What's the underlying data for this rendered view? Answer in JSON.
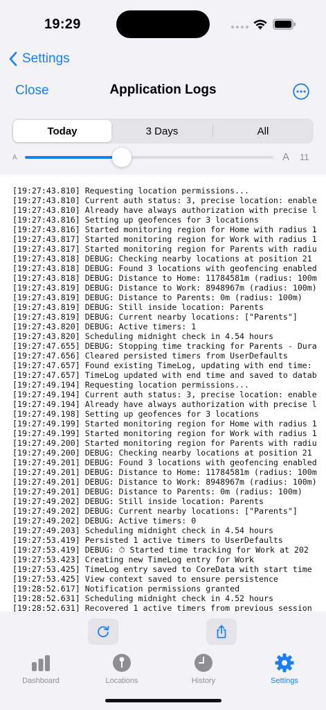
{
  "status_bar": {
    "time": "19:29"
  },
  "nav": {
    "back_label": "Settings",
    "close_label": "Close",
    "title": "Application Logs"
  },
  "segments": [
    "Today",
    "3 Days",
    "All"
  ],
  "slider": {
    "min_label": "A",
    "max_label": "A",
    "value": "11",
    "fraction": 0.39
  },
  "logs": [
    "[19:27:43.810] Requesting location permissions...",
    "[19:27:43.810] Current auth status: 3, precise location: enable",
    "[19:27:43.810] Already have always authorization with precise l",
    "[19:27:43.816] Setting up geofences for 3 locations",
    "[19:27:43.816] Started monitoring region for Home with radius 1",
    "[19:27:43.817] Started monitoring region for Work with radius 1",
    "[19:27:43.817] Started monitoring region for Parents with radiu",
    "[19:27:43.818] DEBUG: Checking nearby locations at position 21",
    "[19:27:43.818] DEBUG: Found 3 locations with geofencing enabled",
    "[19:27:43.818] DEBUG: Distance to Home: 11784581m (radius: 100m",
    "[19:27:43.819] DEBUG: Distance to Work: 8948967m (radius: 100m)",
    "[19:27:43.819] DEBUG: Distance to Parents: 0m (radius: 100m)",
    "[19:27:43.819] DEBUG: Still inside location: Parents",
    "[19:27:43.819] DEBUG: Current nearby locations: [\"Parents\"]",
    "[19:27:43.820] DEBUG: Active timers: 1",
    "[19:27:43.820] Scheduling midnight check in 4.54 hours",
    "[19:27:47.655] DEBUG: Stopping time tracking for Parents - Dura",
    "[19:27:47.656] Cleared persisted timers from UserDefaults",
    "[19:27:47.657] Found existing TimeLog, updating with end time:",
    "[19:27:47.657] TimeLog updated with end time and saved to datab",
    "[19:27:49.194] Requesting location permissions...",
    "[19:27:49.194] Current auth status: 3, precise location: enable",
    "[19:27:49.194] Already have always authorization with precise l",
    "[19:27:49.198] Setting up geofences for 3 locations",
    "[19:27:49.199] Started monitoring region for Home with radius 1",
    "[19:27:49.199] Started monitoring region for Work with radius 1",
    "[19:27:49.200] Started monitoring region for Parents with radiu",
    "[19:27:49.200] DEBUG: Checking nearby locations at position 21",
    "[19:27:49.201] DEBUG: Found 3 locations with geofencing enabled",
    "[19:27:49.201] DEBUG: Distance to Home: 11784581m (radius: 100m",
    "[19:27:49.201] DEBUG: Distance to Work: 8948967m (radius: 100m)",
    "[19:27:49.201] DEBUG: Distance to Parents: 0m (radius: 100m)",
    "[19:27:49.202] DEBUG: Still inside location: Parents",
    "[19:27:49.202] DEBUG: Current nearby locations: [\"Parents\"]",
    "[19:27:49.202] DEBUG: Active timers: 0",
    "[19:27:49.203] Scheduling midnight check in 4.54 hours",
    "[19:27:53.419] Persisted 1 active timers to UserDefaults",
    "[19:27:53.419] DEBUG: ⏱ Started time tracking for Work at 202",
    "[19:27:53.423] Creating new TimeLog entry for Work",
    "[19:27:53.425] TimeLog entry saved to CoreData with start time",
    "[19:27:53.425] View context saved to ensure persistence",
    "[19:28:52.617] Notification permissions granted",
    "[19:28:52.631] Scheduling midnight check in 4.52 hours",
    "[19:28:52.631] Recovered 1 active timers from previous session"
  ],
  "tabs": [
    {
      "label": "Dashboard",
      "icon": "chart-bars-icon"
    },
    {
      "label": "Locations",
      "icon": "pin-icon"
    },
    {
      "label": "History",
      "icon": "clock-icon"
    },
    {
      "label": "Settings",
      "icon": "gear-icon"
    }
  ],
  "colors": {
    "accent": "#1a7ff0",
    "inactive": "#8e8e93"
  }
}
